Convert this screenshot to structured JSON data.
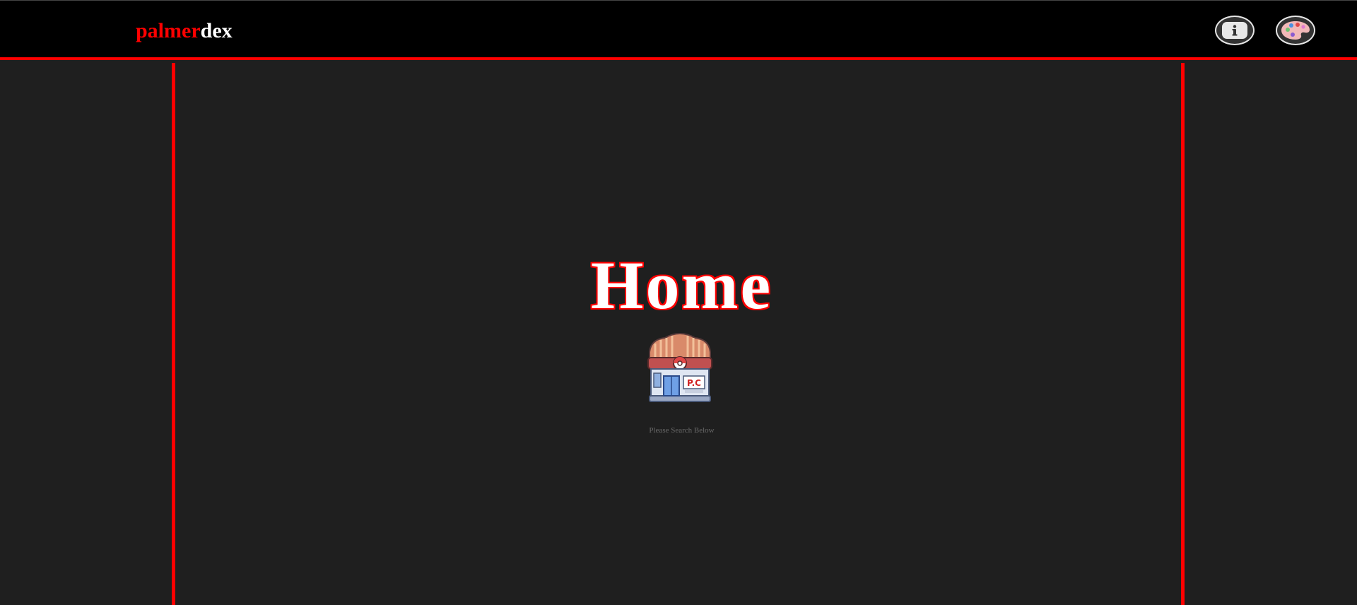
{
  "brand": {
    "part1": "palmer",
    "part2": "dex"
  },
  "header": {
    "info_icon": "info-icon",
    "palette_icon": "palette-icon"
  },
  "main": {
    "title": "Home",
    "image": "pokemon-center-icon",
    "hint": "Please Search Below"
  },
  "colors": {
    "accent": "#ff0000",
    "header_bg": "#000000",
    "page_bg": "#1f1f1f",
    "hint_text": "#6a6a6a"
  }
}
